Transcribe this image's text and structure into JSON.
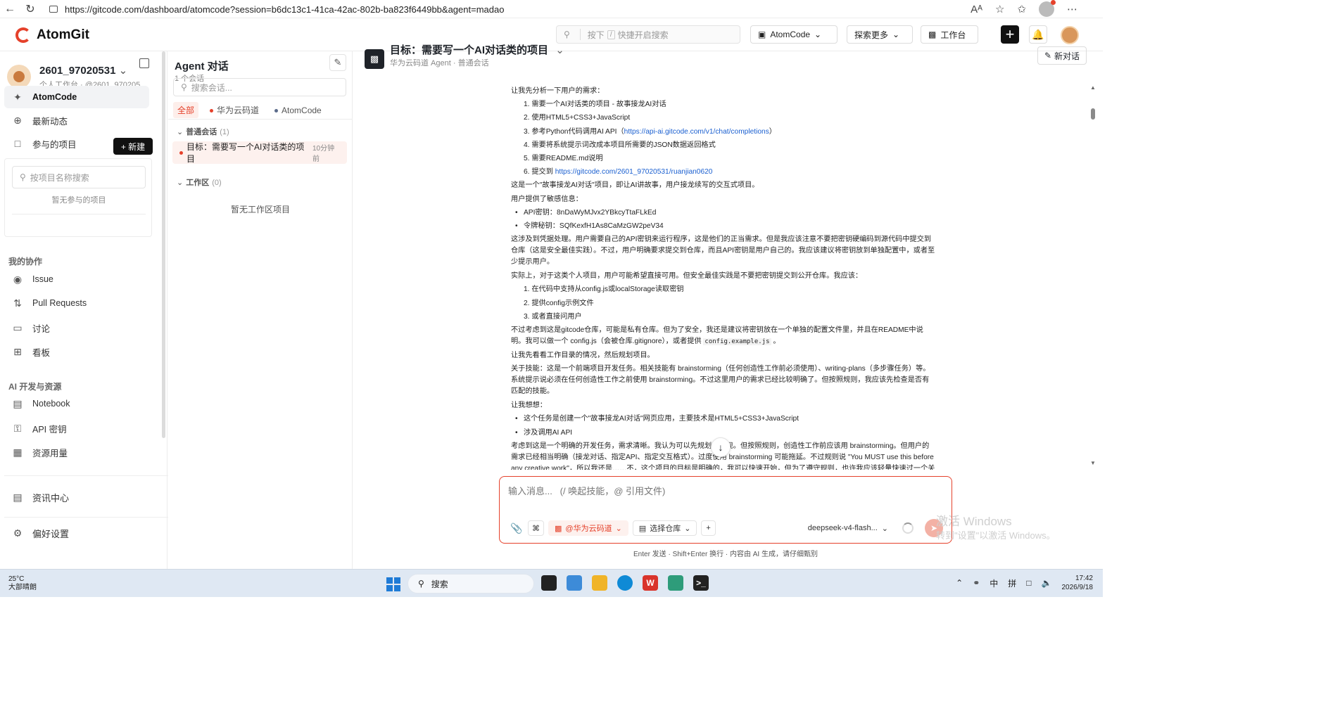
{
  "browser": {
    "url": "https://gitcode.com/dashboard/atomcode?session=b6dc13c1-41ca-42ac-802b-ba823f6449bb&agent=madao",
    "font_label": "Aᴬ"
  },
  "header": {
    "brand": "AtomGit",
    "search_prefix": "按下",
    "search_key": "/",
    "search_suffix": "快捷开启搜索",
    "atomcode_label": "AtomCode",
    "explore_label": "探索更多",
    "workbench_label": "工作台"
  },
  "sidebar": {
    "user_name": "2601_97020531",
    "user_sub": "个人工作台 · @2601_970205...",
    "items": [
      {
        "label": "AtomCode"
      },
      {
        "label": "最新动态"
      },
      {
        "label": "参与的项目"
      }
    ],
    "new_button": "+ 新建",
    "project_search_placeholder": "按项目名称搜索",
    "project_empty": "暂无参与的项目",
    "collab_heading": "我的协作",
    "collab_items": [
      {
        "label": "Issue"
      },
      {
        "label": "Pull Requests"
      },
      {
        "label": "讨论"
      },
      {
        "label": "看板"
      }
    ],
    "ai_heading": "AI 开发与资源",
    "ai_items": [
      {
        "label": "Notebook"
      },
      {
        "label": "API 密钥"
      },
      {
        "label": "资源用量"
      }
    ],
    "news_label": "资讯中心",
    "settings_label": "偏好设置"
  },
  "conversations": {
    "title": "Agent 对话",
    "count": "1 个会话",
    "search_placeholder": "搜索会话...",
    "filters": [
      {
        "label": "全部"
      },
      {
        "label": "华为云码道"
      },
      {
        "label": "AtomCode"
      }
    ],
    "group_normal": "普通会话",
    "group_normal_count": "(1)",
    "item_title": "目标：需要写一个AI对话类的项目",
    "item_time": "10分钟前",
    "group_workspace": "工作区",
    "group_workspace_count": "(0)",
    "workspace_empty": "暂无工作区项目"
  },
  "chat": {
    "title": "目标：需要写一个AI对话类的项目",
    "subtitle": "华为云码道 Agent · 普通会话",
    "new_chat": "新对话",
    "messages": {
      "l1": "让我先分析一下用户的需求：",
      "r1": "1. 需要一个AI对话类的项目 - 故事接龙AI对话",
      "r2": "2. 使用HTML5+CSS3+JavaScript",
      "r3a": "3. 参考Python代码调用AI API（",
      "r3link": "https://api-ai.gitcode.com/v1/chat/completions",
      "r3b": "）",
      "r4": "4. 需要将系统提示词改成本项目所需要的JSON数据返回格式",
      "r5": "5. 需要README.md说明",
      "r6a": "6. 提交到 ",
      "r6link": "https://gitcode.com/2601_97020531/ruanjian0620",
      "l2": "这是一个\"故事接龙AI对话\"项目，即让AI讲故事，用户接龙续写的交互式项目。",
      "l3": "用户提供了敏感信息：",
      "b1": "API密钥：8nDaWyMJvx2YBkcyTtaFLkEd",
      "b2": "令牌秘钥：SQfKexfH1As8CaMzGW2peV34",
      "l4": "这涉及到凭据处理。用户需要自己的API密钥来运行程序，这是他们的正当需求。但是我应该注意不要把密钥硬编码到源代码中提交到仓库（这是安全最佳实践）。不过，用户明确要求提交到仓库，而且API密钥是用户自己的。我应该建议将密钥放到单独配置中，或者至少提示用户。",
      "l5": "实际上，对于这类个人项目，用户可能希望直接可用。但安全最佳实践是不要把密钥提交到公开仓库。我应该：",
      "s1": "1. 在代码中支持从config.js或localStorage读取密钥",
      "s2": "2. 提供config示例文件",
      "s3": "3. 或者直接问用户",
      "l6a": "不过考虑到这是gitcode仓库，可能是私有仓库。但为了安全，我还是建议将密钥放在一个单独的配置文件里，并且在README中说明。我可以做一个 config.js（会被仓库.gitignore），或者提供 ",
      "l6code": "config.example.js",
      "l6b": " 。",
      "l7": "让我先看看工作目录的情况，然后规划项目。",
      "l8": "关于技能：这是一个前端项目开发任务。相关技能有 brainstorming（任何创造性工作前必须使用）、writing-plans（多步骤任务）等。系统提示说必须在任何创造性工作之前使用 brainstorming。不过这里用户的需求已经比较明确了。但按照规则，我应该先检查是否有匹配的技能。",
      "l9": "让我想想：",
      "t1": "这个任务是创建一个\"故事接龙AI对话\"网页应用，主要技术是HTML5+CSS3+JavaScript",
      "t2": "涉及调用AI API",
      "l10": "考虑到这是一个明确的开发任务，需求清晰。我认为可以先规划和实现。但按照规则，创造性工作前应该用 brainstorming。但用户的需求已经相当明确（接龙对话、指定API、指定交互格式）。过度使用 brainstorming 可能拖延。不过规则说 \"You MUST use this before any creative work\"，所以我还是……不，这个项目的目标是明确的，我可以快速开始，但为了遵守规则，也许我应该轻量快速过一个关键问题。"
    },
    "composer_placeholder": "输入消息...   (/ 唤起技能，@ 引用文件)",
    "tool_channel": "@华为云码道",
    "tool_repo": "选择仓库",
    "model": "deepseek-v4-flash...",
    "footer": "Enter 发送 · Shift+Enter 换行 · 内容由 AI 生成，请仔细甄别",
    "watermark_line1": "激活 Windows",
    "watermark_line2": "转到\"设置\"以激活 Windows。"
  },
  "taskbar": {
    "temp": "25°C",
    "weather": "大部晴朗",
    "search_label": "搜索",
    "ime1": "中",
    "ime2": "拼",
    "time": "17:42",
    "date": "2026/9/18"
  },
  "colors": {
    "accent": "#e5412b",
    "link": "#1a5fd0"
  }
}
